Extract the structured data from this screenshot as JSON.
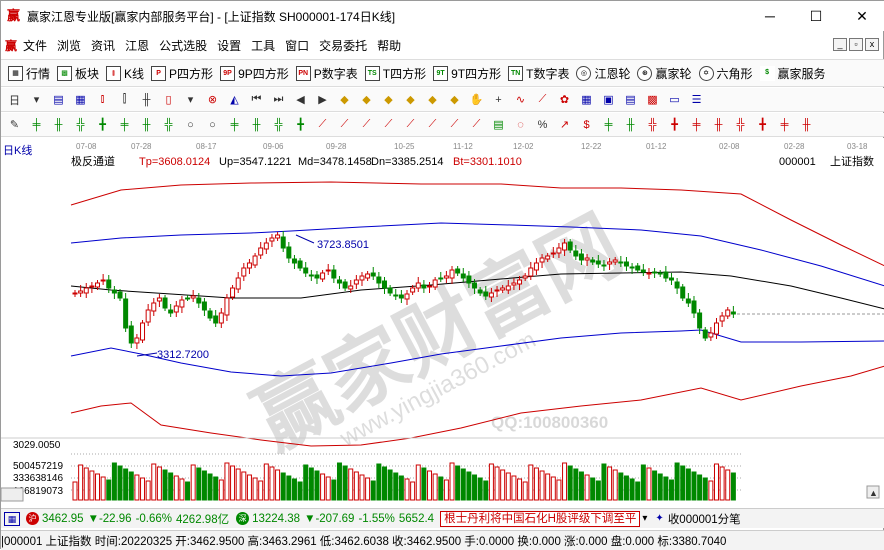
{
  "window": {
    "title": "赢家江恩专业版[赢家内部服务平台] - [上证指数 SH000001-174日K线]",
    "min": "─",
    "max": "☐",
    "close": "✕",
    "logo": "赢"
  },
  "menu": {
    "logo": "赢",
    "items": [
      "文件",
      "浏览",
      "资讯",
      "江恩",
      "公式选股",
      "设置",
      "工具",
      "窗口",
      "交易委托",
      "帮助"
    ]
  },
  "toolbar1": [
    {
      "icon": "grid-icon",
      "label": "行情"
    },
    {
      "icon": "blocks-icon",
      "label": "板块"
    },
    {
      "icon": "candle-icon",
      "label": "K线"
    },
    {
      "icon": "P",
      "label": "P四方形"
    },
    {
      "icon": "9P",
      "label": "9P四方形"
    },
    {
      "icon": "PN",
      "label": "P数字表"
    },
    {
      "icon": "TS",
      "label": "T四方形"
    },
    {
      "icon": "9T",
      "label": "9T四方形"
    },
    {
      "icon": "TN",
      "label": "T数字表"
    },
    {
      "icon": "circle-icon",
      "label": "江恩轮"
    },
    {
      "icon": "wheel-icon",
      "label": "赢家轮"
    },
    {
      "icon": "hexagram-icon",
      "label": "六角形"
    },
    {
      "icon": "dollar-icon",
      "label": "赢家服务"
    }
  ],
  "chart_header": {
    "period": "日K线",
    "dates": [
      "07-08",
      "07-28",
      "08-17",
      "09-06",
      "09-28",
      "10-25",
      "11-12",
      "12-02",
      "12-22",
      "01-12",
      "02-08",
      "02-28",
      "03-18"
    ],
    "indicator": "极反通道",
    "tp": "Tp=3608.0124",
    "up": "Up=3547.1221",
    "md": "Md=3478.1458",
    "dn": "Dn=3385.2514",
    "bt": "Bt=3301.1010",
    "code": "000001",
    "name": "上证指数",
    "high_label": "3723.8501",
    "low_label": "3312.7200",
    "watermark_phone": "QQ:100800360",
    "watermark_site": "www.yingjia360.com",
    "vol_axis": [
      "3029.0050",
      "500457219",
      "333638146",
      "166819073"
    ]
  },
  "status1": {
    "sh_value": "3462.95",
    "sh_change": "▼-22.96",
    "sh_pct": "-0.66%",
    "sh_amount": "4262.98亿",
    "sz_value": "13224.38",
    "sz_change": "▼-207.69",
    "sz_pct": "-1.55%",
    "sz_amount": "5652.4",
    "ticker": "根士丹利将中国石化H股评级下调至平",
    "right": "收000001分笔"
  },
  "status2": {
    "text": "|000001 上证指数 时间:20220325 开:3462.9500 高:3463.2961 低:3462.6038 收:3462.9500 手:0.0000 换:0.000 涨:0.000 盘:0.000 标:3380.7040"
  },
  "colors": {
    "up": "#cc0000",
    "down": "#008800",
    "band_outer": "#cc0000",
    "band_inner": "#0000cc",
    "mid": "#000000"
  }
}
